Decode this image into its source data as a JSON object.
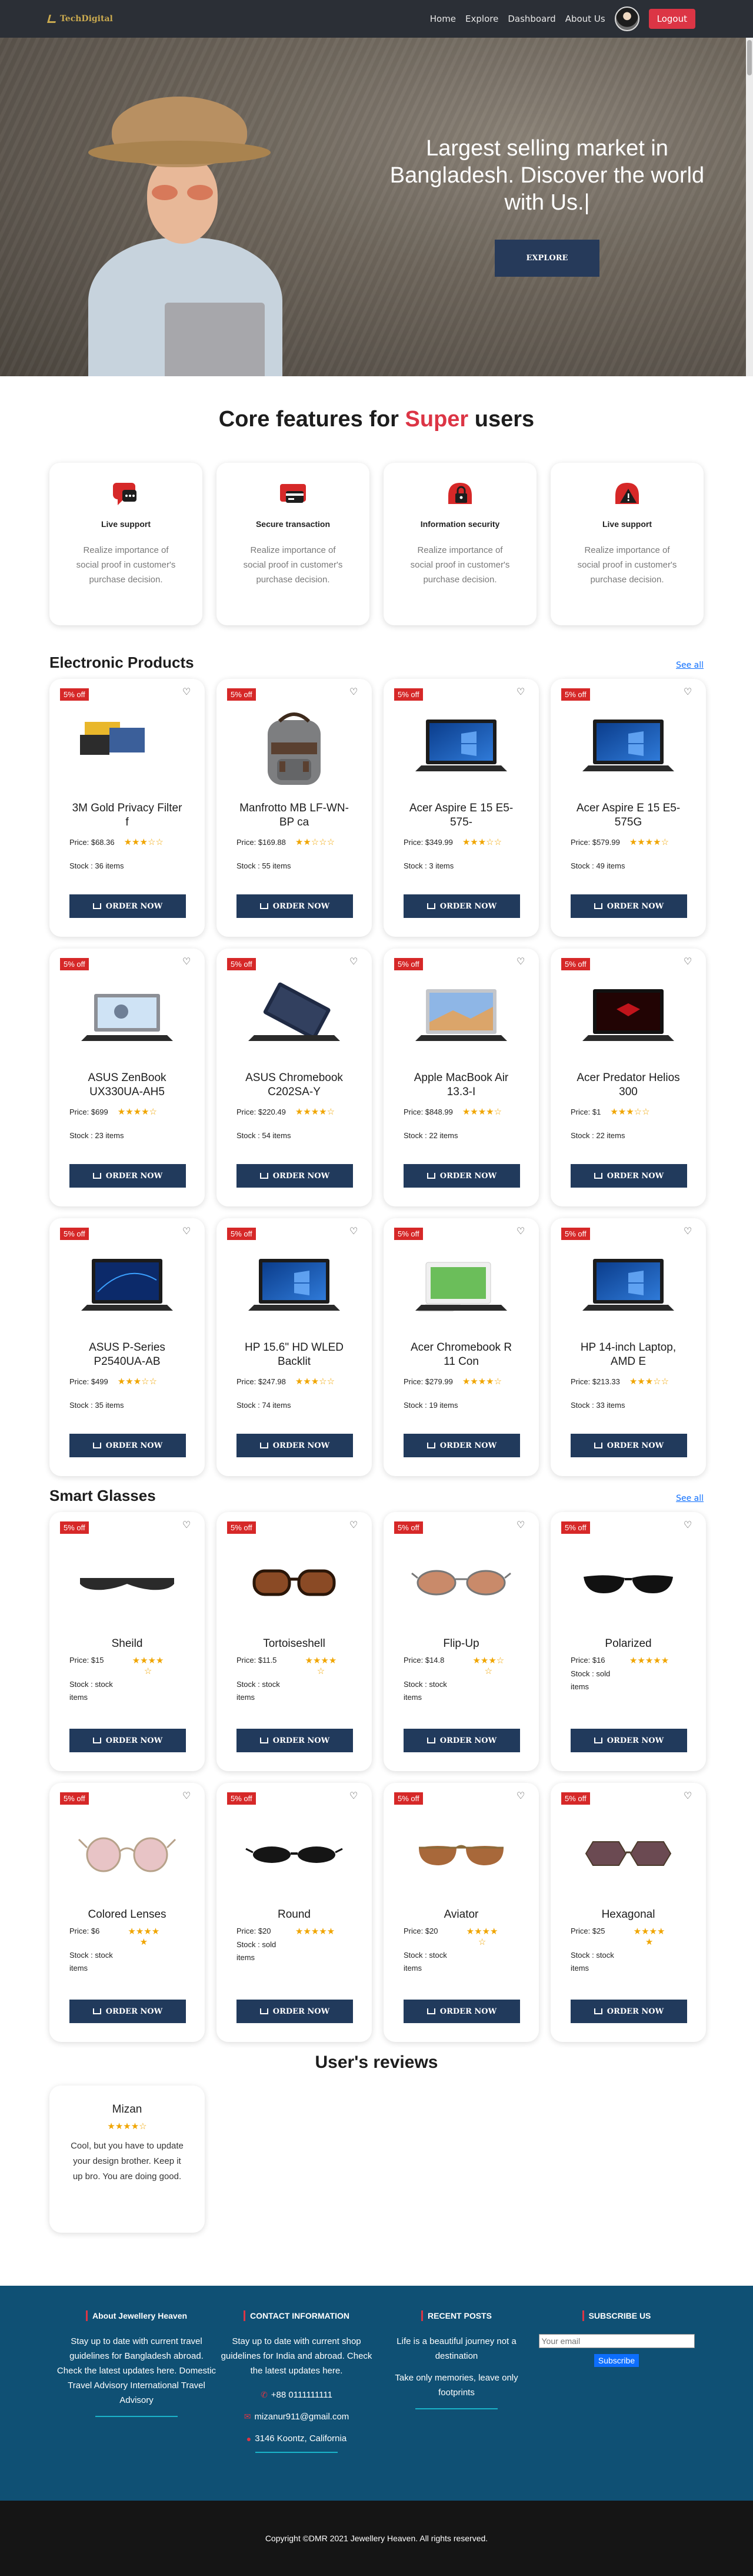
{
  "navbar": {
    "brand": "TechDigital",
    "links": [
      "Home",
      "Explore",
      "Dashboard",
      "About Us"
    ],
    "logout": "Logout"
  },
  "hero": {
    "title": "Largest selling market in Bangladesh. Discover the world with Us.|",
    "button": "EXPLORE"
  },
  "core": {
    "title_prefix": "Core features for ",
    "title_accent": "Super",
    "title_suffix": " users",
    "features": [
      {
        "name": "Live support",
        "desc": "Realize importance of social proof in customer's purchase decision.",
        "icon": "chat-support-icon"
      },
      {
        "name": "Secure transaction",
        "desc": "Realize importance of social proof in customer's purchase decision.",
        "icon": "credit-card-icon"
      },
      {
        "name": "Information security",
        "desc": "Realize importance of social proof in customer's purchase decision.",
        "icon": "lock-icon"
      },
      {
        "name": "Live support",
        "desc": "Realize importance of social proof in customer's purchase decision.",
        "icon": "warning-icon"
      }
    ]
  },
  "electronics": {
    "title": "Electronic Products",
    "see_all": "See all",
    "products": [
      {
        "badge": "5% off",
        "name": "3M Gold Privacy Filter f",
        "price": "Price: $68.36",
        "rating": "★★★☆☆",
        "stock": "Stock : 36 items",
        "order": "ORDER NOW"
      },
      {
        "badge": "5% off",
        "name": "Manfrotto MB LF-WN-BP ca",
        "price": "Price: $169.88",
        "rating": "★★☆☆☆",
        "stock": "Stock : 55 items",
        "order": "ORDER NOW"
      },
      {
        "badge": "5% off",
        "name": "Acer Aspire E 15 E5-575-",
        "price": "Price: $349.99",
        "rating": "★★★☆☆",
        "stock": "Stock : 3 items",
        "order": "ORDER NOW"
      },
      {
        "badge": "5% off",
        "name": "Acer Aspire E 15 E5-575G",
        "price": "Price: $579.99",
        "rating": "★★★★☆",
        "stock": "Stock : 49 items",
        "order": "ORDER NOW"
      },
      {
        "badge": "5% off",
        "name": "ASUS ZenBook UX330UA-AH5",
        "price": "Price: $699",
        "rating": "★★★★☆",
        "stock": "Stock : 23 items",
        "order": "ORDER NOW"
      },
      {
        "badge": "5% off",
        "name": "ASUS Chromebook C202SA-Y",
        "price": "Price: $220.49",
        "rating": "★★★★☆",
        "stock": "Stock : 54 items",
        "order": "ORDER NOW"
      },
      {
        "badge": "5% off",
        "name": "Apple MacBook Air 13.3-I",
        "price": "Price: $848.99",
        "rating": "★★★★☆",
        "stock": "Stock : 22 items",
        "order": "ORDER NOW"
      },
      {
        "badge": "5% off",
        "name": "Acer Predator Helios 300",
        "price": "Price: $1",
        "rating": "★★★☆☆",
        "stock": "Stock : 22 items",
        "order": "ORDER NOW"
      },
      {
        "badge": "5% off",
        "name": "ASUS P-Series P2540UA-AB",
        "price": "Price: $499",
        "rating": "★★★☆☆",
        "stock": "Stock : 35 items",
        "order": "ORDER NOW"
      },
      {
        "badge": "5% off",
        "name": "HP 15.6\" HD WLED Backlit",
        "price": "Price: $247.98",
        "rating": "★★★☆☆",
        "stock": "Stock : 74 items",
        "order": "ORDER NOW"
      },
      {
        "badge": "5% off",
        "name": "Acer Chromebook R 11 Con",
        "price": "Price: $279.99",
        "rating": "★★★★☆",
        "stock": "Stock : 19 items",
        "order": "ORDER NOW"
      },
      {
        "badge": "5% off",
        "name": "HP 14-inch Laptop, AMD E",
        "price": "Price: $213.33",
        "rating": "★★★☆☆",
        "stock": "Stock : 33 items",
        "order": "ORDER NOW"
      }
    ]
  },
  "glasses": {
    "title": "Smart Glasses",
    "see_all": "See all",
    "products": [
      {
        "badge": "5% off",
        "name": "Sheild",
        "price": "Price: $15",
        "rating": "★★★★ ☆",
        "stock": "Stock : stock items",
        "order": "ORDER NOW",
        "lens": "#2a2a2a"
      },
      {
        "badge": "5% off",
        "name": "Tortoiseshell",
        "price": "Price: $11.5",
        "rating": "★★★★ ☆",
        "stock": "Stock : stock items",
        "order": "ORDER NOW",
        "lens": "#8a4a25"
      },
      {
        "badge": "5% off",
        "name": "Flip-Up",
        "price": "Price: $14.8",
        "rating": "★★★☆ ☆",
        "stock": "Stock : stock items",
        "order": "ORDER NOW",
        "lens": "#c98a6a"
      },
      {
        "badge": "5% off",
        "name": "Polarized",
        "price": "Price: $16",
        "rating": "★★★★★",
        "stock": "Stock : sold items",
        "order": "ORDER NOW",
        "lens": "#111111"
      },
      {
        "badge": "5% off",
        "name": "Colored Lenses",
        "price": "Price: $6",
        "rating": "★★★★ ★",
        "stock": "Stock : stock items",
        "order": "ORDER NOW",
        "lens": "#e8c4c6"
      },
      {
        "badge": "5% off",
        "name": "Round",
        "price": "Price: $20",
        "rating": "★★★★★",
        "stock": "Stock : sold items",
        "order": "ORDER NOW",
        "lens": "#151515"
      },
      {
        "badge": "5% off",
        "name": "Aviator",
        "price": "Price: $20",
        "rating": "★★★★ ☆",
        "stock": "Stock : stock items",
        "order": "ORDER NOW",
        "lens": "#a8683a"
      },
      {
        "badge": "5% off",
        "name": "Hexagonal",
        "price": "Price: $25",
        "rating": "★★★★ ★",
        "stock": "Stock : stock items",
        "order": "ORDER NOW",
        "lens": "#6b4a52"
      }
    ]
  },
  "reviews": {
    "title": "User's reviews",
    "items": [
      {
        "name": "Mizan",
        "rating": "★★★★☆",
        "text": "Cool, but you have to update your design brother. Keep it up bro. You are doing good."
      }
    ]
  },
  "footer": {
    "about_title": "About Jewellery Heaven",
    "about_text": "Stay up to date with current travel guidelines for Bangladesh abroad. Check the latest updates here. Domestic Travel Advisory International Travel Advisory",
    "contact_title": "CONTACT INFORMATION",
    "contact_text": "Stay up to date with current shop guidelines for India and abroad. Check the latest updates here.",
    "phone": "+88 0111111111",
    "email": "mizanur911@gmail.com",
    "address": "3146 Koontz, California",
    "recent_title": "RECENT POSTS",
    "recent_1": "Life is a beautiful journey not a destination",
    "recent_2": "Take only memories, leave only footprints",
    "subscribe_title": "SUBSCRIBE US",
    "subscribe_placeholder": "Your email",
    "subscribe_button": "Subscribe",
    "copyright": "Copyright ©DMR 2021 Jewellery Heaven. All rights reserved."
  },
  "colors": {
    "accent": "#dc3545",
    "button": "#213a5c",
    "footer": "#0f5074",
    "star": "#f0a500"
  }
}
